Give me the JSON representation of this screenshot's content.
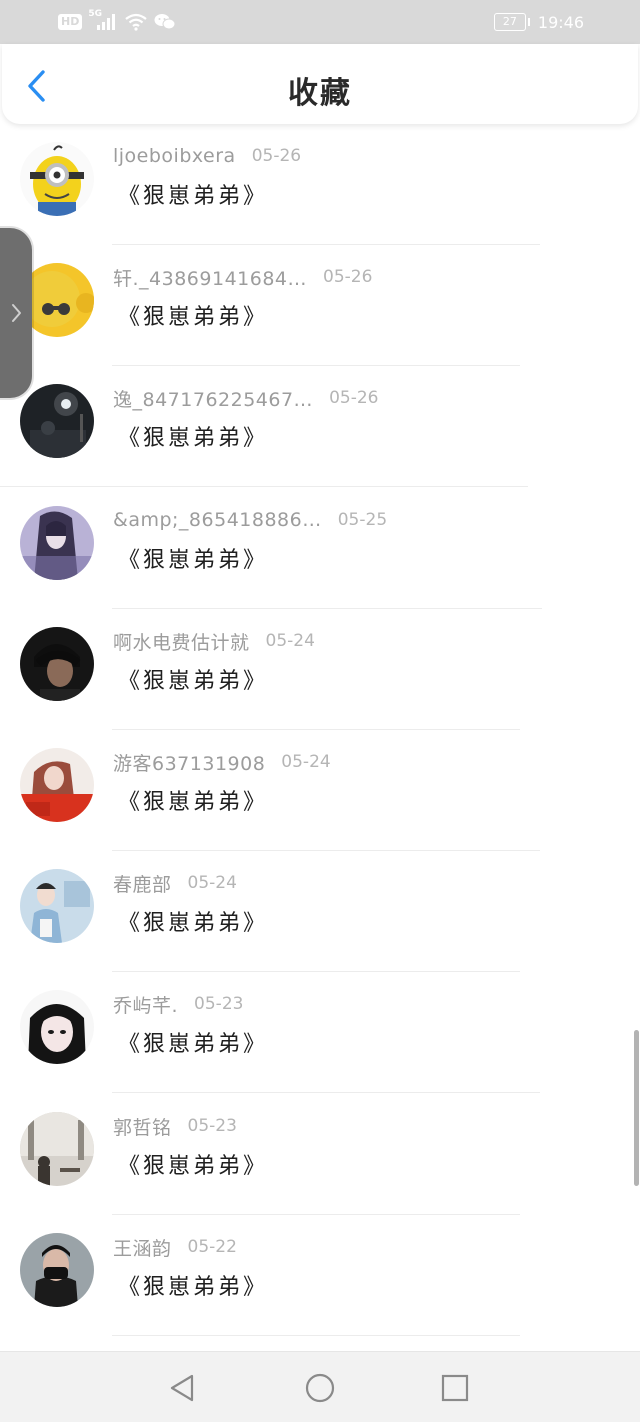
{
  "status_bar": {
    "hd": "HD",
    "network": "5G",
    "battery": "27",
    "time": "19:46"
  },
  "header": {
    "title": "收藏",
    "back_icon": "chevron-left-icon"
  },
  "side_handle_icon": "chevron-right-icon",
  "items": [
    {
      "username": "ljoeboibxera",
      "date": "05-26",
      "content": "《狠崽弟弟》"
    },
    {
      "username": "轩._43869141684…",
      "date": "05-26",
      "content": "《狠崽弟弟》"
    },
    {
      "username": "逸_847176225467…",
      "date": "05-26",
      "content": "《狠崽弟弟》"
    },
    {
      "username": "&amp;_865418886…",
      "date": "05-25",
      "content": "《狠崽弟弟》"
    },
    {
      "username": "啊水电费估计就",
      "date": "05-24",
      "content": "《狠崽弟弟》"
    },
    {
      "username": "游客637131908",
      "date": "05-24",
      "content": "《狠崽弟弟》"
    },
    {
      "username": "春鹿部",
      "date": "05-24",
      "content": "《狠崽弟弟》"
    },
    {
      "username": "乔屿芊.",
      "date": "05-23",
      "content": "《狠崽弟弟》"
    },
    {
      "username": "郭哲铭",
      "date": "05-23",
      "content": "《狠崽弟弟》"
    },
    {
      "username": "王涵韵",
      "date": "05-22",
      "content": "《狠崽弟弟》"
    }
  ],
  "nav_bar": {
    "back_icon": "triangle-back-icon",
    "home_icon": "circle-home-icon",
    "recents_icon": "square-recents-icon"
  }
}
